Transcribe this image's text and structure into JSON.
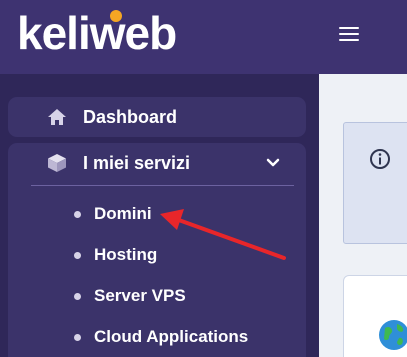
{
  "header": {
    "logo_text": "keliweb",
    "menu_icon": "hamburger-menu-icon"
  },
  "sidebar": {
    "items": [
      {
        "label": "Dashboard",
        "icon": "home-icon"
      },
      {
        "label": "I miei servizi",
        "icon": "box-icon",
        "expanded": true,
        "toggle_icon": "chevron-down-icon"
      }
    ],
    "subitems": [
      {
        "label": "Domini"
      },
      {
        "label": "Hosting"
      },
      {
        "label": "Server VPS"
      },
      {
        "label": "Cloud Applications"
      }
    ]
  },
  "content": {
    "info_icon": "info-icon",
    "card_icon": "globe-icon"
  },
  "annotation": {
    "arrow_color": "#e8262a",
    "target": "Domini"
  },
  "colors": {
    "topbar": "#3e3371",
    "sidebar": "#2f2759",
    "nav_card": "#3b336a",
    "logo_dot": "#f5a623",
    "content_bg": "#eef1f6",
    "info_box": "#dde3f2"
  }
}
